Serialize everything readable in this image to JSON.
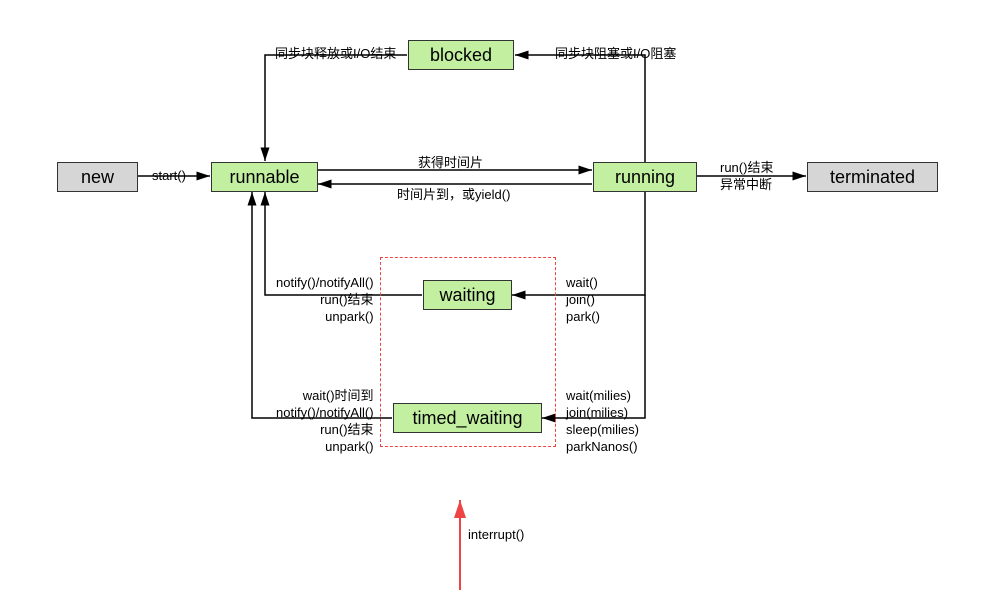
{
  "nodes": {
    "new": "new",
    "runnable": "runnable",
    "running": "running",
    "blocked": "blocked",
    "waiting": "waiting",
    "timed_waiting": "timed_waiting",
    "terminated": "terminated"
  },
  "edges": {
    "start": "start()",
    "acquire_timeslice": "获得时间片",
    "timeslice_or_yield": "时间片到，或yield()",
    "sync_block_or_io": "同步块阻塞或I/O阻塞",
    "sync_release_or_io_end": "同步块释放或I/O结束",
    "run_end_or_exception": "run()结束\n异常中断",
    "to_waiting": "wait()\njoin()\npark()",
    "from_waiting": "notify()/notifyAll()\nrun()结束\nunpark()",
    "to_timed_waiting": "wait(milies)\njoin(milies)\nsleep(milies)\nparkNanos()",
    "from_timed_waiting": "wait()时间到\nnotify()/notifyAll()\nrun()结束\nunpark()",
    "interrupt": "interrupt()"
  },
  "colors": {
    "green": "#c2f0a0",
    "grey": "#d6d6d6",
    "red": "#e44",
    "black": "#000000"
  }
}
